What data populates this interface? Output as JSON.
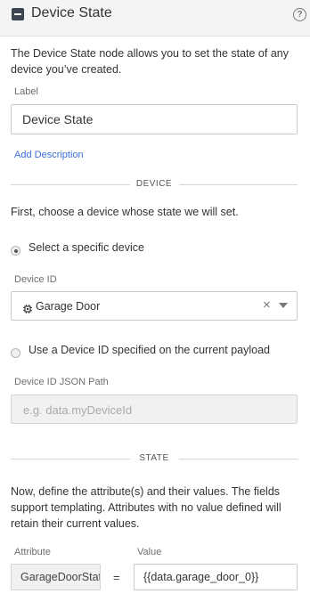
{
  "header": {
    "title": "Device State",
    "help_glyph": "?"
  },
  "intro": "The Device State node allows you to set the state of any device you’ve created.",
  "label_field": {
    "label": "Label",
    "value": "Device State"
  },
  "add_description": "Add Description",
  "device_section": {
    "title": "DEVICE",
    "instructions": "First, choose a device whose state we will set.",
    "option_specific": "Select a specific device",
    "device_id_label": "Device ID",
    "device_id_value": "Garage Door",
    "clear_glyph": "×",
    "option_payload": "Use a Device ID specified on the current payload",
    "json_path_label": "Device ID JSON Path",
    "json_path_placeholder": "e.g. data.myDeviceId"
  },
  "state_section": {
    "title": "STATE",
    "instructions": "Now, define the attribute(s) and their values. The fields support templating. Attributes with no value defined will retain their current values.",
    "attribute_header": "Attribute",
    "value_header": "Value",
    "rows": [
      {
        "attribute": "GarageDoorState",
        "equals": "=",
        "value": "{{data.garage_door_0}}"
      }
    ]
  }
}
